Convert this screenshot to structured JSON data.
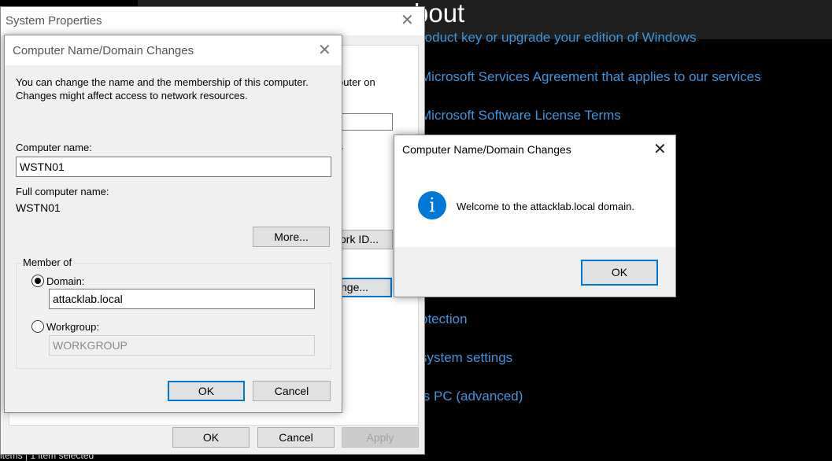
{
  "background": {
    "heading": "bout",
    "links": [
      "roduct key or upgrade your edition of Windows",
      "Microsoft Services Agreement that applies to our services",
      "Microsoft Software License Terms",
      "otection",
      "system settings",
      "is PC (advanced)"
    ],
    "status_bar": "items  |  1 item selected",
    "link_color": "#3a96dd"
  },
  "system_properties": {
    "title": "System Properties",
    "close_icon": "close-icon",
    "fragments": {
      "tab_edge": "e",
      "computer_on": "puter on",
      "apostrophe_s": "'s",
      "network_id": "ork ID...",
      "change": "nge..."
    },
    "buttons": {
      "ok": "OK",
      "cancel": "Cancel",
      "apply": "Apply"
    }
  },
  "domain_dialog": {
    "title": "Computer Name/Domain Changes",
    "description_line1": "You can change the name and the membership of this computer.",
    "description_line2": "Changes might affect access to network resources.",
    "computer_name_label": "Computer name:",
    "computer_name_value": "WSTN01",
    "full_name_label": "Full computer name:",
    "full_name_value": "WSTN01",
    "more_button": "More...",
    "member_of_label": "Member of",
    "domain_label": "Domain:",
    "domain_value": "attacklab.local",
    "domain_selected": true,
    "workgroup_label": "Workgroup:",
    "workgroup_value": "WORKGROUP",
    "ok_button": "OK",
    "cancel_button": "Cancel"
  },
  "welcome_dialog": {
    "title": "Computer Name/Domain Changes",
    "icon": "info-icon",
    "icon_glyph": "i",
    "message": "Welcome to the attacklab.local domain.",
    "ok_button": "OK",
    "accent_color": "#0078d7"
  }
}
